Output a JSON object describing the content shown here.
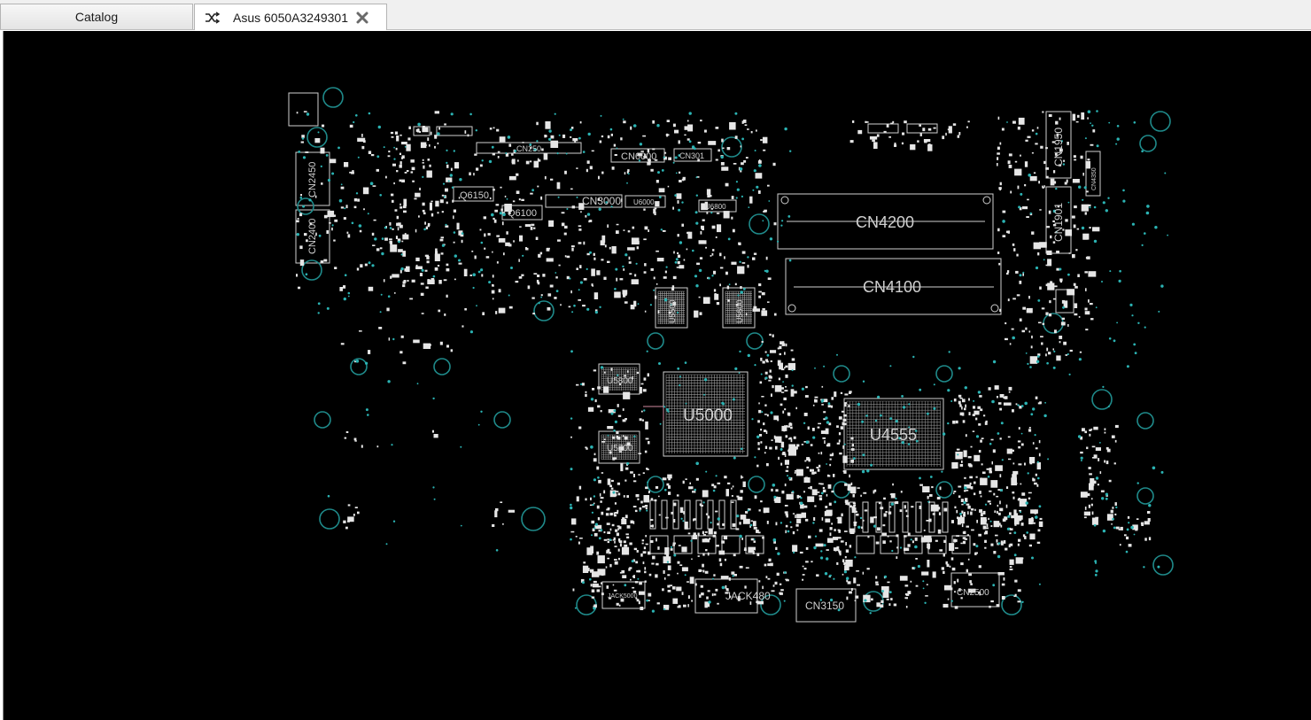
{
  "tabs": [
    {
      "label": "Catalog",
      "active": false
    },
    {
      "label": "Asus 6050A3249301",
      "active": true
    }
  ],
  "icons": {
    "tab_board": "shuffle-icon",
    "tab_close": "close-icon"
  },
  "colors": {
    "canvas_bg": "#000000",
    "outline": "#cfcfcf",
    "via_ring": "#1f8a8a",
    "pad": "#e6e6e6"
  },
  "board": {
    "components": {
      "cn4200": "CN4200",
      "cn4100": "CN4100",
      "u5000": "U5000",
      "u4555": "U4555",
      "u5800": "U5800",
      "u5700": "U5700",
      "cn1950": "CN1950",
      "cn1901": "CN1901",
      "cn2450": "CN2450",
      "cn2400": "CN2400",
      "cn3000": "CN3000",
      "cn6000": "CN6000",
      "cn301": "CN301",
      "cn250": "CN250",
      "q6150": "Q6150",
      "q6100": "Q6100",
      "u5500": "U5500",
      "u5600": "U5600",
      "jack480": "JACK480",
      "jack5000": "JACK5000",
      "cn3150": "CN3150",
      "cn2500": "CN2500",
      "cn4350": "CN4350",
      "u6000": "U6000",
      "u6800": "U6800"
    }
  }
}
